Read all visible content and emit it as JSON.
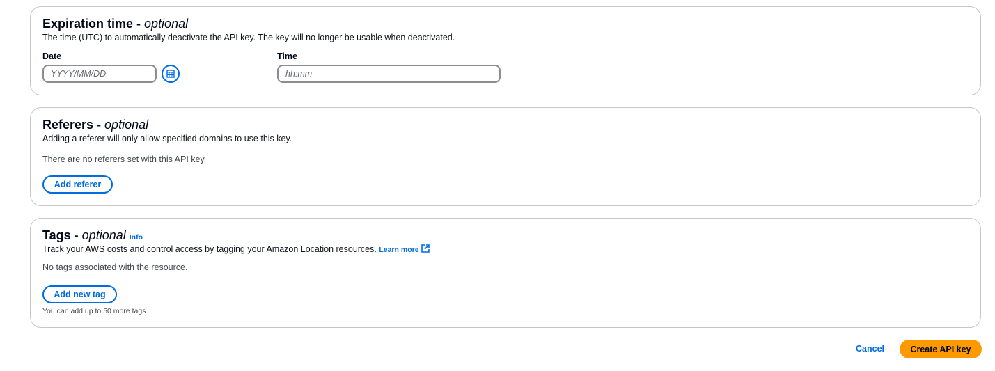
{
  "expiration": {
    "title": "Expiration time - ",
    "title_optional": "optional",
    "description": "The time (UTC) to automatically deactivate the API key. The key will no longer be usable when deactivated.",
    "date_label": "Date",
    "date_placeholder": "YYYY/MM/DD",
    "time_label": "Time",
    "time_placeholder": "hh:mm"
  },
  "referers": {
    "title": "Referers - ",
    "title_optional": "optional",
    "description": "Adding a referer will only allow specified domains to use this key.",
    "empty": "There are no referers set with this API key.",
    "add_label": "Add referer"
  },
  "tags": {
    "title": "Tags - ",
    "title_optional": "optional",
    "info": "Info",
    "description": "Track your AWS costs and control access by tagging your Amazon Location resources.",
    "learn_more": "Learn more",
    "empty": "No tags associated with the resource.",
    "add_label": "Add new tag",
    "limit": "You can add up to 50 more tags."
  },
  "footer": {
    "cancel": "Cancel",
    "create": "Create API key"
  }
}
